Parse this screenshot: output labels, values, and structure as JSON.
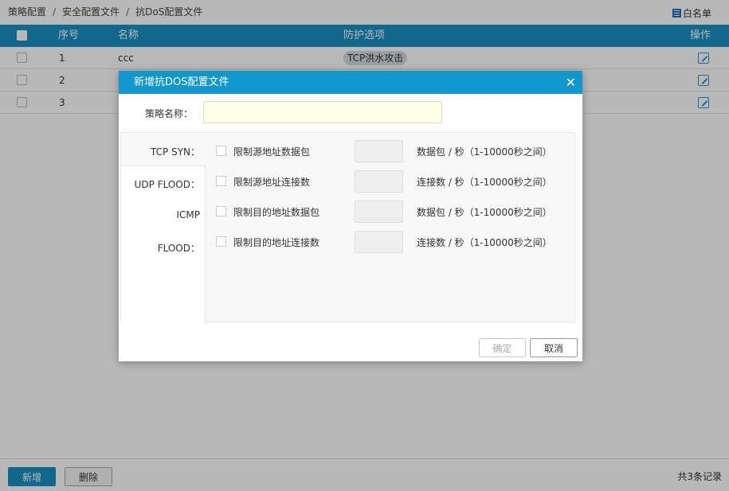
{
  "breadcrumb": {
    "items": [
      "策略配置",
      "安全配置文件",
      "抗DoS配置文件"
    ],
    "separator": "/"
  },
  "whitelist_label": "白名单",
  "table": {
    "headers": {
      "index": "序号",
      "name": "名称",
      "protection": "防护选项",
      "action": "操作"
    },
    "rows": [
      {
        "index": "1",
        "name": "ccc",
        "protection": "TCP洪水攻击"
      },
      {
        "index": "2",
        "name": "",
        "protection": ""
      },
      {
        "index": "3",
        "name": "",
        "protection": ""
      }
    ]
  },
  "footer": {
    "add_label": "新增",
    "delete_label": "删除",
    "record_count": "共3条记录"
  },
  "modal": {
    "title": "新增抗DOS配置文件",
    "close_glyph": "✕",
    "policy_name_label": "策略名称：",
    "policy_name_value": "",
    "tabs": [
      "TCP SYN：",
      "UDP FLOOD：",
      "ICMP",
      "FLOOD："
    ],
    "options": [
      {
        "label": "限制源地址数据包",
        "value": "",
        "unit": "数据包 / 秒（1-10000秒之间）"
      },
      {
        "label": "限制源地址连接数",
        "value": "",
        "unit": "连接数 / 秒（1-10000秒之间）"
      },
      {
        "label": "限制目的地址数据包",
        "value": "",
        "unit": "数据包 / 秒（1-10000秒之间）"
      },
      {
        "label": "限制目的地址连接数",
        "value": "",
        "unit": "连接数 / 秒（1-10000秒之间）"
      }
    ],
    "ok_label": "确定",
    "cancel_label": "取消"
  },
  "colors": {
    "accent": "#1a8fc4",
    "modal_header": "#1197cd",
    "input_highlight": "#fefde6"
  }
}
